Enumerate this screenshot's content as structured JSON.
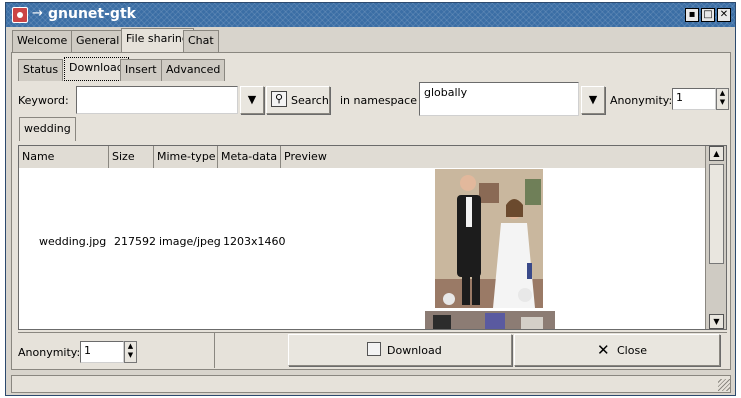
{
  "window": {
    "title": "gnunet-gtk",
    "controls": [
      "▪",
      "□",
      "✕"
    ]
  },
  "main_tabs": [
    "Welcome",
    "General",
    "File sharing",
    "Chat"
  ],
  "sub_tabs": [
    "Status",
    "Download",
    "Insert",
    "Advanced"
  ],
  "search": {
    "keyword_label": "Keyword:",
    "keyword_value": "",
    "search_label": "Search",
    "namespace_label": "in namespace",
    "namespace_value": "globally",
    "anonymity_label": "Anonymity:",
    "anonymity_value": "1"
  },
  "result_tab": "wedding",
  "table": {
    "columns": [
      "Name",
      "Size",
      "Mime-type",
      "Meta-data",
      "Preview"
    ],
    "rows": [
      {
        "name": "wedding.jpg",
        "size": "217592",
        "mime": "image/jpeg",
        "meta": "1203x1460"
      }
    ]
  },
  "bottom": {
    "anonymity_label": "Anonymity:",
    "anonymity_value": "1",
    "download_label": "Download",
    "close_label": "Close"
  },
  "colors": {
    "titlebar": "#3b6ea5",
    "panel": "#e6e2da",
    "window": "#d8d4cc"
  }
}
